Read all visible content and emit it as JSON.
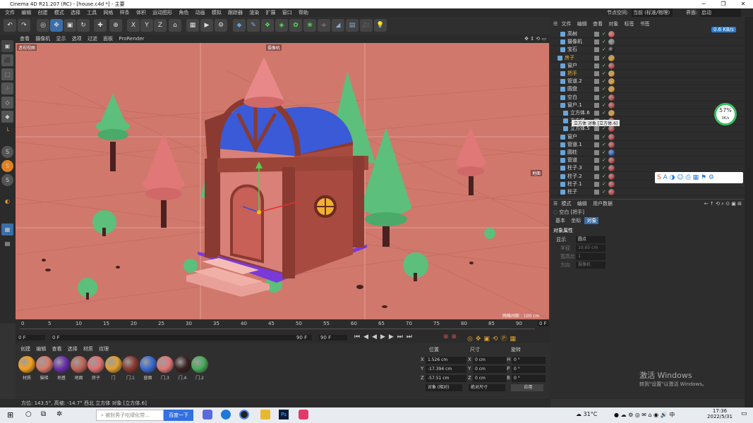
{
  "window": {
    "title": "Cinema 4D R21.207 (RC) - [house.c4d *] - 主要"
  },
  "menu": [
    "文件",
    "编辑",
    "创建",
    "模式",
    "选择",
    "工具",
    "网格",
    "样条",
    "体积",
    "运动图形",
    "角色",
    "动画",
    "模拟",
    "跟踪器",
    "渲染",
    "扩展",
    "窗口",
    "帮助"
  ],
  "layout": {
    "node_space_label": "节点空间:",
    "node_space_value": "当前 (标准/物理)",
    "interface_label": "界面:",
    "interface_value": "启动"
  },
  "viewport": {
    "menu": [
      "查看",
      "摄像机",
      "显示",
      "选项",
      "过滤",
      "面板",
      "ProRender"
    ],
    "view_name": "透视视图",
    "camera_label": "摄像机",
    "grid_label": "网格间距 : 100 cm",
    "note_label": "地面"
  },
  "timeline": {
    "ticks": [
      "0",
      "5",
      "10",
      "15",
      "20",
      "25",
      "30",
      "35",
      "40",
      "45",
      "50",
      "55",
      "60",
      "65",
      "70",
      "75",
      "80",
      "85",
      "90"
    ],
    "frame_current": "0 F",
    "frame_start": "0 F",
    "frame_end": "90 F",
    "frame_end2": "90 F",
    "frame_right": "0 F"
  },
  "materials": {
    "menu": [
      "创建",
      "编辑",
      "查看",
      "选择",
      "材质",
      "纹理"
    ],
    "items": [
      {
        "label": "材质",
        "color": "#f5a020"
      },
      {
        "label": "猫梯",
        "color": "#d97a6a"
      },
      {
        "label": "地基",
        "color": "#6a2fb0"
      },
      {
        "label": "地面",
        "color": "#c0655a"
      },
      {
        "label": "房子",
        "color": "#e07070"
      },
      {
        "label": "门",
        "color": "#e0a030"
      },
      {
        "label": "门.1",
        "color": "#8a3a30"
      },
      {
        "label": "窗面",
        "color": "#3a6ad0"
      },
      {
        "label": "门.3",
        "color": "#e07878"
      },
      {
        "label": "门.4",
        "color": "#3a2222"
      },
      {
        "label": "门.2",
        "color": "#4aaa5a"
      }
    ]
  },
  "coords": {
    "headers": {
      "pos": "位置",
      "size": "尺寸",
      "rot": "旋转"
    },
    "rows": [
      {
        "axis": "X",
        "pos": "1.526 cm",
        "axis2": "X",
        "size": "0 cm",
        "axis3": "H",
        "rot": "0 °"
      },
      {
        "axis": "Y",
        "pos": "-17.394 cm",
        "axis2": "Y",
        "size": "0 cm",
        "axis3": "P",
        "rot": "0 °"
      },
      {
        "axis": "Z",
        "pos": "-57.51 cm",
        "axis2": "Z",
        "size": "0 cm",
        "axis3": "B",
        "rot": "0 °"
      }
    ],
    "mode": "对象 (相对)",
    "size_mode": "绝对尺寸",
    "apply": "应用"
  },
  "status": "方位: 143.5°, 高坡: -14.7° 西北   立方体 对象 [立方体.6]",
  "objects": {
    "menu": [
      "文件",
      "编辑",
      "查看",
      "对象",
      "标签",
      "书签"
    ],
    "rows": [
      {
        "name": "高树",
        "color": "#e06060"
      },
      {
        "name": "摄像机",
        "color": "#888888"
      },
      {
        "name": "宝石",
        "color": "#222222"
      },
      {
        "name": "房子",
        "color": "#e0a030"
      },
      {
        "name": "窗户",
        "color": "#c05050"
      },
      {
        "name": "把手",
        "color": "#e0a030"
      },
      {
        "name": "管道.2",
        "color": "#e0a030"
      },
      {
        "name": "圆盘",
        "color": "#e0a030"
      },
      {
        "name": "空白",
        "color": "#c05050"
      },
      {
        "name": "窗户.1",
        "color": "#c05050"
      },
      {
        "name": "立方体.6",
        "color": "#e0a030"
      },
      {
        "name": "立方体",
        "color": "#c05050"
      },
      {
        "name": "立方体.5",
        "color": "#c05050"
      },
      {
        "name": "窗户",
        "color": "#c05050"
      },
      {
        "name": "管道.1",
        "color": "#c05050"
      },
      {
        "name": "圆柱",
        "color": "#3a6ad0"
      },
      {
        "name": "管道",
        "color": "#c05050"
      },
      {
        "name": "柱子.3",
        "color": "#c05050"
      },
      {
        "name": "柱子.2",
        "color": "#c05050"
      },
      {
        "name": "柱子.1",
        "color": "#c05050"
      },
      {
        "name": "柱子",
        "color": "#c05050"
      }
    ],
    "tooltip": "立方体 对象 [立方体.6]"
  },
  "attributes": {
    "menu": [
      "模式",
      "编辑",
      "用户数据"
    ],
    "title": "空白 [把手]",
    "tabs": [
      "基本",
      "坐标",
      "对象"
    ],
    "section": "对象属性",
    "fields": [
      {
        "label": "显示",
        "value": "圆点"
      },
      {
        "label": "半径",
        "value": "10.65 cm"
      },
      {
        "label": "宽高比",
        "value": "1"
      },
      {
        "label": "方向",
        "value": "摄像机"
      }
    ]
  },
  "net": {
    "speed": "0.6 KB/s",
    "percent": "57%",
    "rate": "0K/s"
  },
  "watermark": {
    "line1": "激活 Windows",
    "line2": "转到\"设置\"以激活 Windows。"
  },
  "taskbar": {
    "search_placeholder": "被封男子吃绿化带...",
    "search_button": "百度一下",
    "weather": "31°C",
    "time": "17:36",
    "date": "2022/5/31"
  }
}
